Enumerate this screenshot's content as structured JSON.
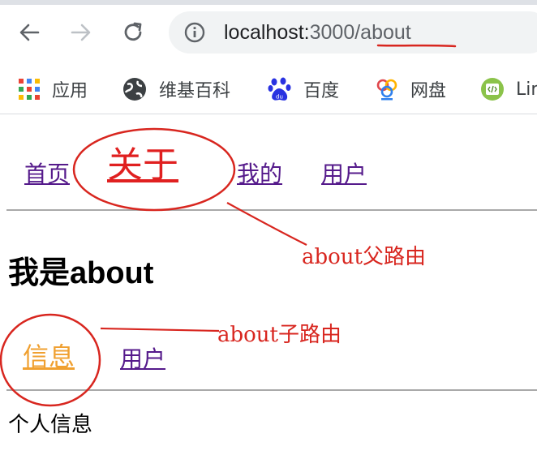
{
  "browser": {
    "url_host": "localhost:",
    "url_rest": "3000/about",
    "bookmarks": [
      {
        "label": "应用",
        "icon": "apps-grid-icon"
      },
      {
        "label": "维基百科",
        "icon": "globe-icon"
      },
      {
        "label": "百度",
        "icon": "baidu-paw-icon"
      },
      {
        "label": "网盘",
        "icon": "cloud-drive-icon"
      },
      {
        "label": "Lin",
        "icon": "code-icon"
      }
    ]
  },
  "nav": {
    "home": "首页",
    "about": "关于",
    "mine": "我的",
    "users": "用户"
  },
  "about_page": {
    "heading": "我是about",
    "sub_nav": {
      "info": "信息",
      "users": "用户"
    },
    "content": "个人信息"
  },
  "annotations": {
    "parent_route": "about父路由",
    "child_route": "about子路由"
  },
  "colors": {
    "visited_link": "#551a8b",
    "active_link_parent": "#e02020",
    "active_link_child": "#f0a030",
    "annotation": "#d8261f"
  }
}
